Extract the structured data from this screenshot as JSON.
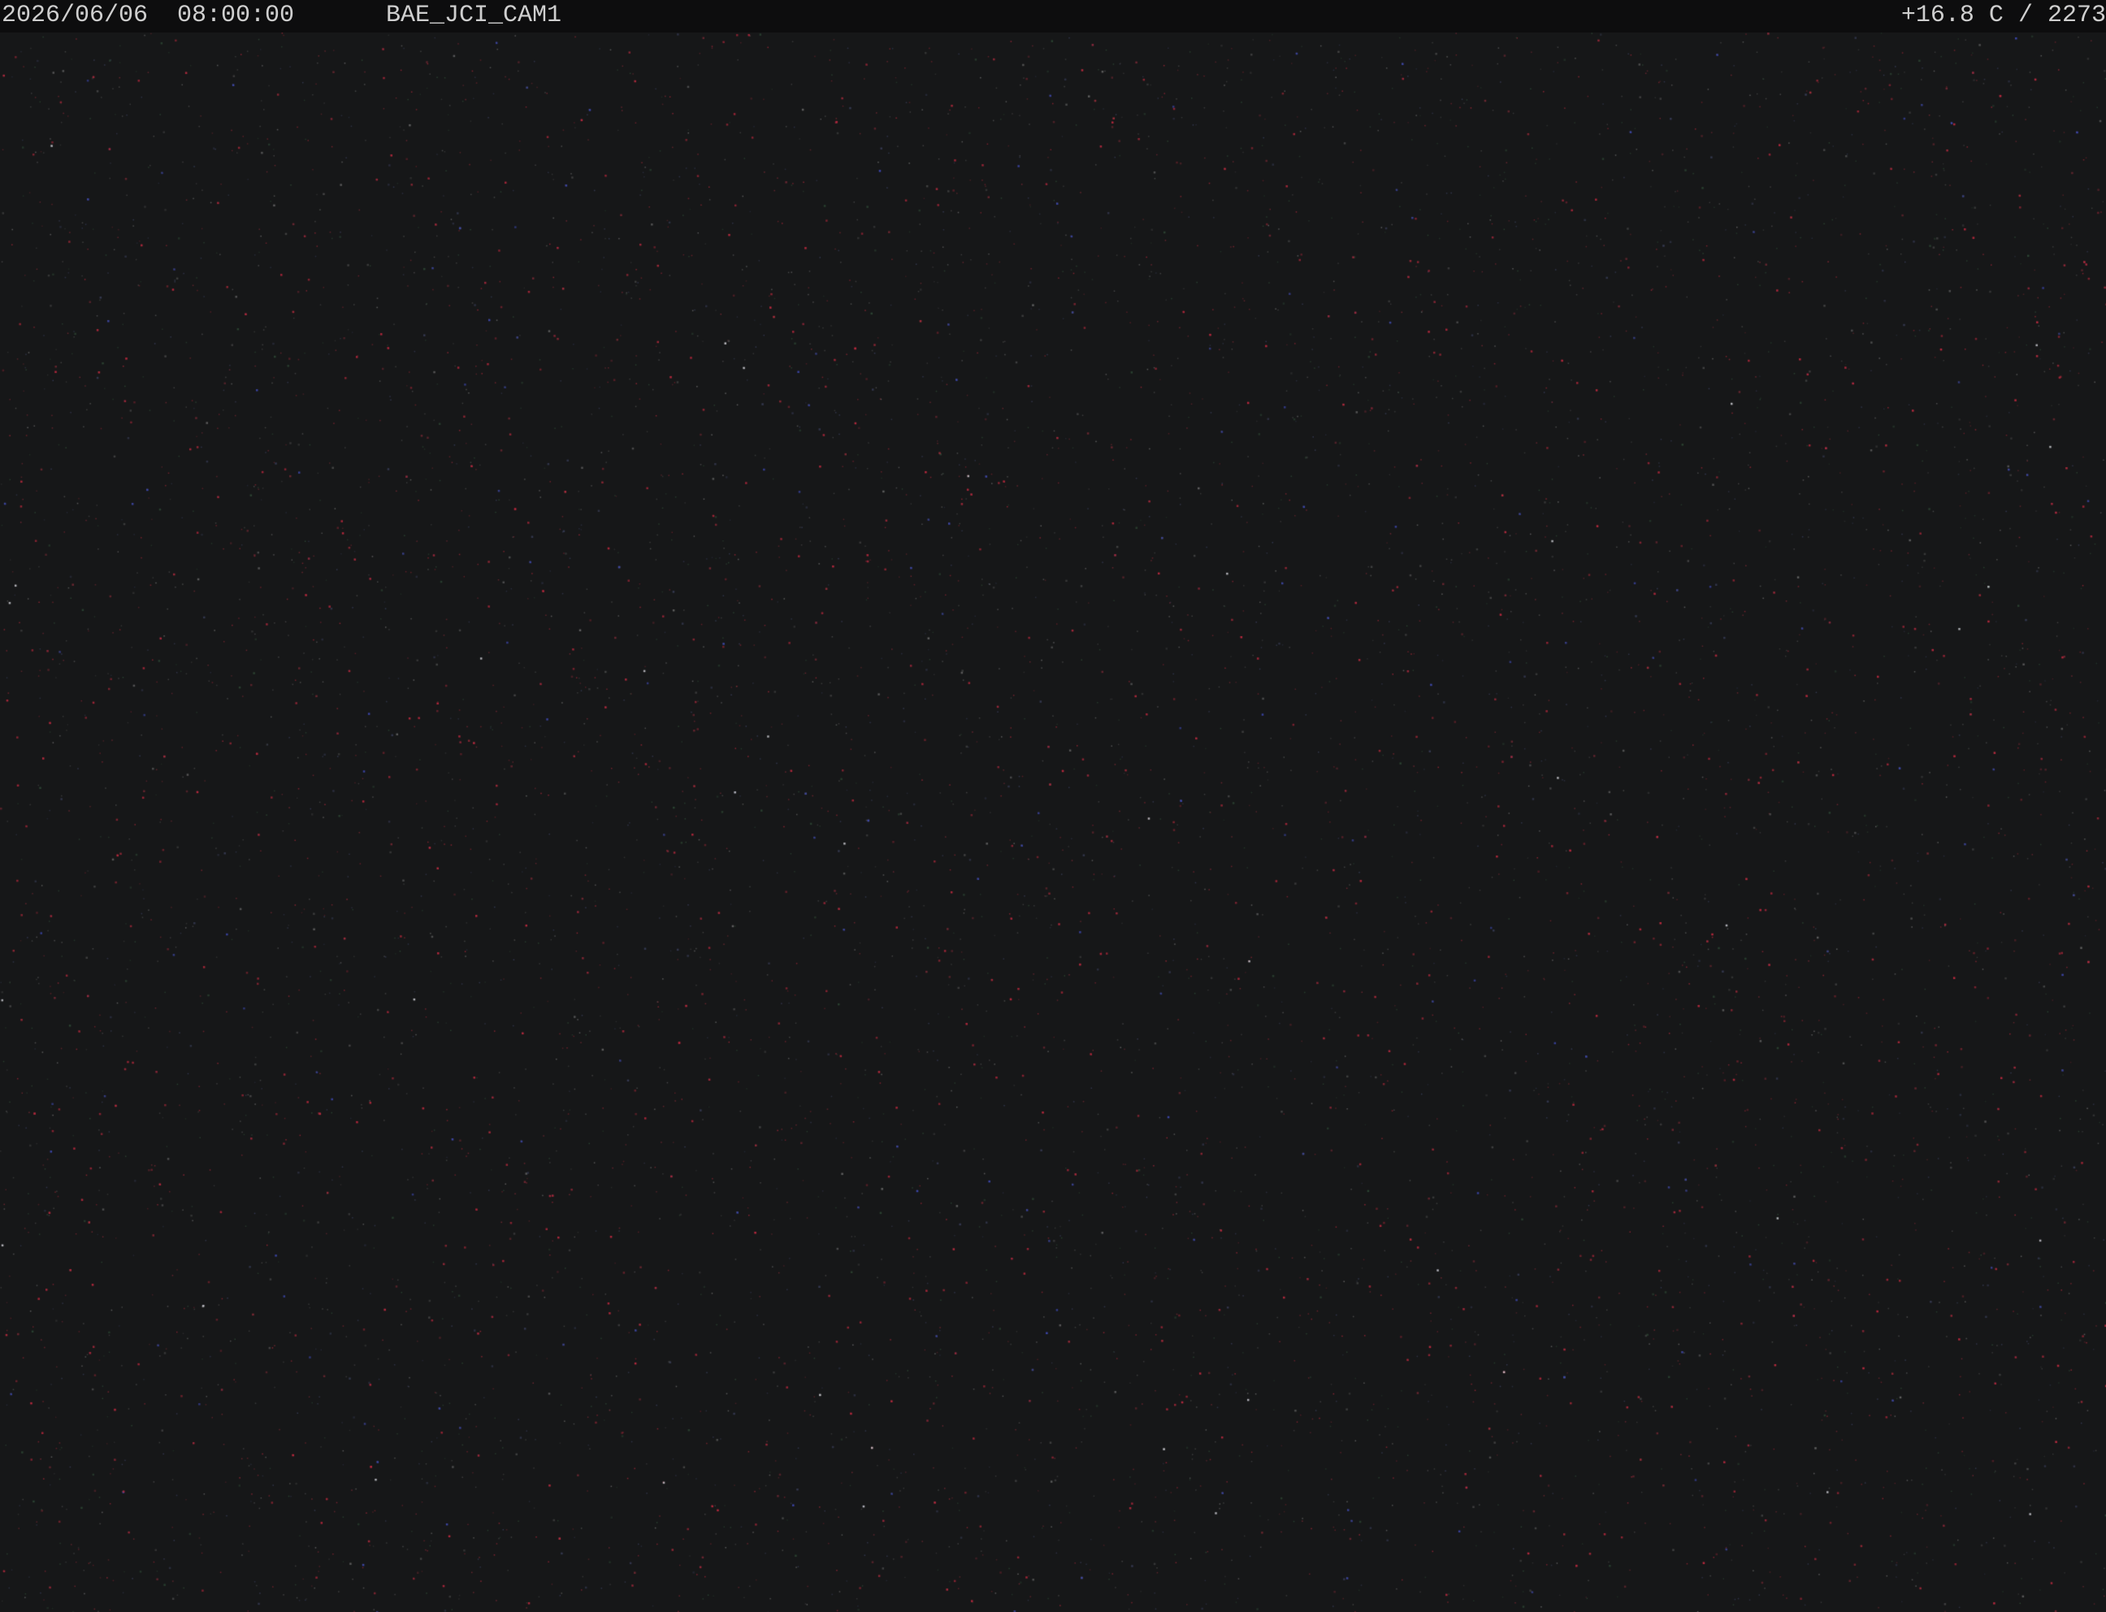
{
  "overlay": {
    "date": "2026/06/06",
    "time": "08:00:00",
    "camera_name": "BAE_JCI_CAM1",
    "temperature": "+16.8 C",
    "separator": "/",
    "frame_count": "2273"
  },
  "scene": {
    "description_type": "night-sky-camera-frame",
    "background_color": "#161718",
    "overlay_bar_color": "#0d0d0e",
    "overlay_text_color": "#cfcfcf",
    "noise_colors": [
      "#7a2a35",
      "#a02838",
      "#3a3f5a",
      "#2f4a36",
      "#4a4a4a",
      "#6c6c6c"
    ],
    "bright_star_color": "#e8e8f0"
  }
}
